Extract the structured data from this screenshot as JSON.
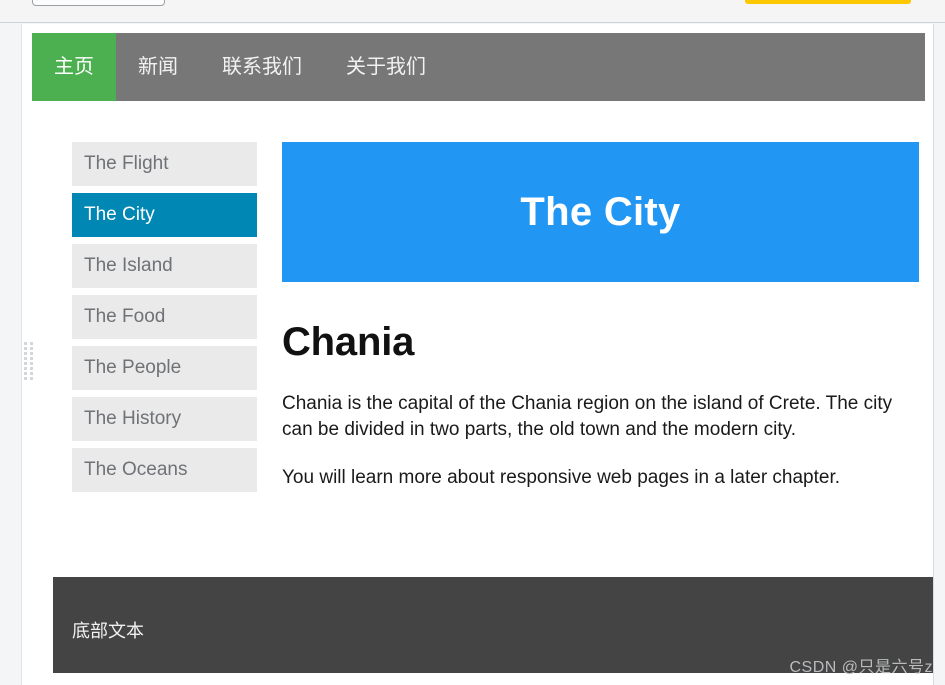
{
  "chrome": {
    "left_chip_name": "address-chip",
    "right_chip_name": "yellow-bar-chip",
    "accent_yellow": "#fdc800"
  },
  "navbar": {
    "background": "#777777",
    "active_background": "#4CAF50",
    "items": [
      {
        "label": "主页",
        "active": true
      },
      {
        "label": "新闻",
        "active": false
      },
      {
        "label": "联系我们",
        "active": false
      },
      {
        "label": "关于我们",
        "active": false
      }
    ]
  },
  "sidebar": {
    "item_background": "#eaeaea",
    "active_background": "#0087b4",
    "items": [
      {
        "label": "The Flight",
        "active": false
      },
      {
        "label": "The City",
        "active": true
      },
      {
        "label": "The Island",
        "active": false
      },
      {
        "label": "The Food",
        "active": false
      },
      {
        "label": "The People",
        "active": false
      },
      {
        "label": "The History",
        "active": false
      },
      {
        "label": "The Oceans",
        "active": false
      }
    ]
  },
  "main": {
    "hero_title": "The City",
    "hero_background": "#2196f3",
    "heading": "Chania",
    "paragraph_1": "Chania is the capital of the Chania region on the island of Crete. The city can be divided in two parts, the old town and the modern city.",
    "paragraph_2": "You will learn more about responsive web pages in a later chapter."
  },
  "footer": {
    "text": "底部文本",
    "background": "#444444"
  },
  "watermark": {
    "text": "CSDN @只是六号z"
  }
}
